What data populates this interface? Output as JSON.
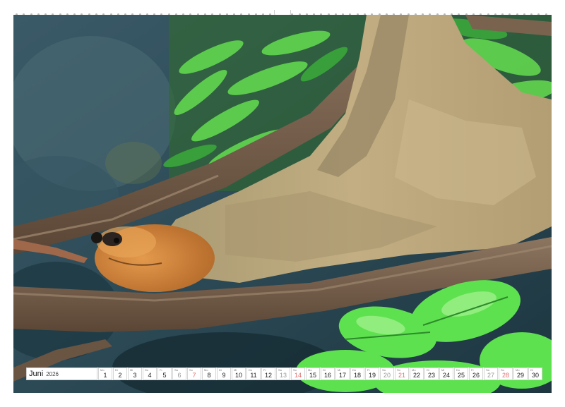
{
  "calendar": {
    "month": "Juni",
    "year": "2026",
    "days": [
      {
        "wd": "Mo",
        "d": "1",
        "kind": "wk"
      },
      {
        "wd": "Di",
        "d": "2",
        "kind": "wk"
      },
      {
        "wd": "Mi",
        "d": "3",
        "kind": "wk"
      },
      {
        "wd": "Do",
        "d": "4",
        "kind": "wk"
      },
      {
        "wd": "Fr",
        "d": "5",
        "kind": "wk"
      },
      {
        "wd": "Sa",
        "d": "6",
        "kind": "sat"
      },
      {
        "wd": "So",
        "d": "7",
        "kind": "sun"
      },
      {
        "wd": "Mo",
        "d": "8",
        "kind": "wk"
      },
      {
        "wd": "Di",
        "d": "9",
        "kind": "wk"
      },
      {
        "wd": "Mi",
        "d": "10",
        "kind": "wk"
      },
      {
        "wd": "Do",
        "d": "11",
        "kind": "wk"
      },
      {
        "wd": "Fr",
        "d": "12",
        "kind": "wk"
      },
      {
        "wd": "Sa",
        "d": "13",
        "kind": "sat"
      },
      {
        "wd": "So",
        "d": "14",
        "kind": "sun"
      },
      {
        "wd": "Mo",
        "d": "15",
        "kind": "wk"
      },
      {
        "wd": "Di",
        "d": "16",
        "kind": "wk"
      },
      {
        "wd": "Mi",
        "d": "17",
        "kind": "wk"
      },
      {
        "wd": "Do",
        "d": "18",
        "kind": "wk"
      },
      {
        "wd": "Fr",
        "d": "19",
        "kind": "wk"
      },
      {
        "wd": "Sa",
        "d": "20",
        "kind": "sat"
      },
      {
        "wd": "So",
        "d": "21",
        "kind": "sun"
      },
      {
        "wd": "Mo",
        "d": "22",
        "kind": "wk"
      },
      {
        "wd": "Di",
        "d": "23",
        "kind": "wk"
      },
      {
        "wd": "Mi",
        "d": "24",
        "kind": "wk"
      },
      {
        "wd": "Do",
        "d": "25",
        "kind": "wk"
      },
      {
        "wd": "Fr",
        "d": "26",
        "kind": "wk"
      },
      {
        "wd": "Sa",
        "d": "27",
        "kind": "sat"
      },
      {
        "wd": "So",
        "d": "28",
        "kind": "sun"
      },
      {
        "wd": "Mo",
        "d": "29",
        "kind": "wk"
      },
      {
        "wd": "Di",
        "d": "30",
        "kind": "wk"
      }
    ]
  },
  "colors": {
    "saturday": "#999999",
    "sunday": "#e07070",
    "leaf_green": "#3fd13a",
    "fur": "#b8a47a",
    "face": "#d8863a",
    "branch": "#7a634e"
  },
  "icons": {
    "spiral": "wire-binding-holes",
    "hanger": "calendar-hanger-notch"
  }
}
